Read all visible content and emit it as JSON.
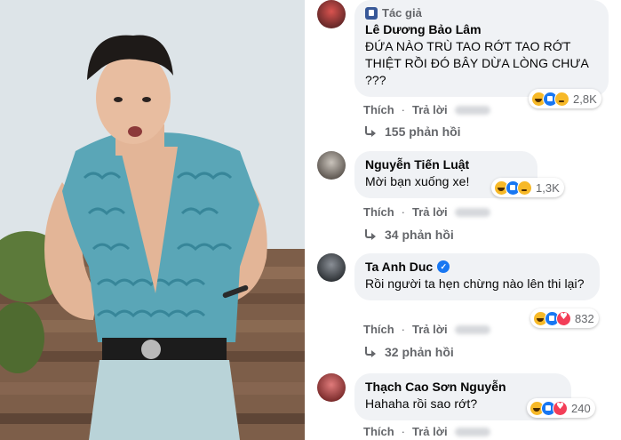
{
  "photo": {
    "alt": ""
  },
  "comments": [
    {
      "author_tag": "Tác giả",
      "name": "Lê Dương Bảo Lâm",
      "text": "ĐỨA NÀO TRÙ TAO RỚT TAO RỚT THIỆT RỒI ĐÓ BÂY DỪA LÒNG CHƯA ???",
      "reaction_count": "2,8K",
      "actions": {
        "like": "Thích",
        "reply": "Trả lời"
      },
      "replies": "155 phản hồi",
      "verified": false
    },
    {
      "author_tag": "",
      "name": "Nguyễn Tiến Luật",
      "text": "Mời bạn xuống xe!",
      "reaction_count": "1,3K",
      "actions": {
        "like": "Thích",
        "reply": "Trả lời"
      },
      "replies": "34 phản hồi",
      "verified": false
    },
    {
      "author_tag": "",
      "name": "Ta Anh Duc",
      "text": "Rồi người ta hẹn chừng nào lên thi lại?",
      "reaction_count": "832",
      "actions": {
        "like": "Thích",
        "reply": "Trả lời"
      },
      "replies": "32 phản hồi",
      "verified": true
    },
    {
      "author_tag": "",
      "name": "Thạch Cao Sơn Nguyễn",
      "text": "Hahaha rồi sao rớt?",
      "reaction_count": "240",
      "actions": {
        "like": "Thích",
        "reply": "Trả lời"
      },
      "replies": "",
      "verified": false
    }
  ],
  "colors": {
    "bubble": "#f0f2f5",
    "meta_text": "#65676b",
    "like_blue": "#1877f2",
    "haha_yellow": "#f7b928",
    "love_red": "#f33e58"
  },
  "icons": [
    "author-badge-icon",
    "haha-reaction-icon",
    "like-reaction-icon",
    "sad-reaction-icon",
    "love-reaction-icon",
    "reply-arrow-icon",
    "verified-icon"
  ]
}
